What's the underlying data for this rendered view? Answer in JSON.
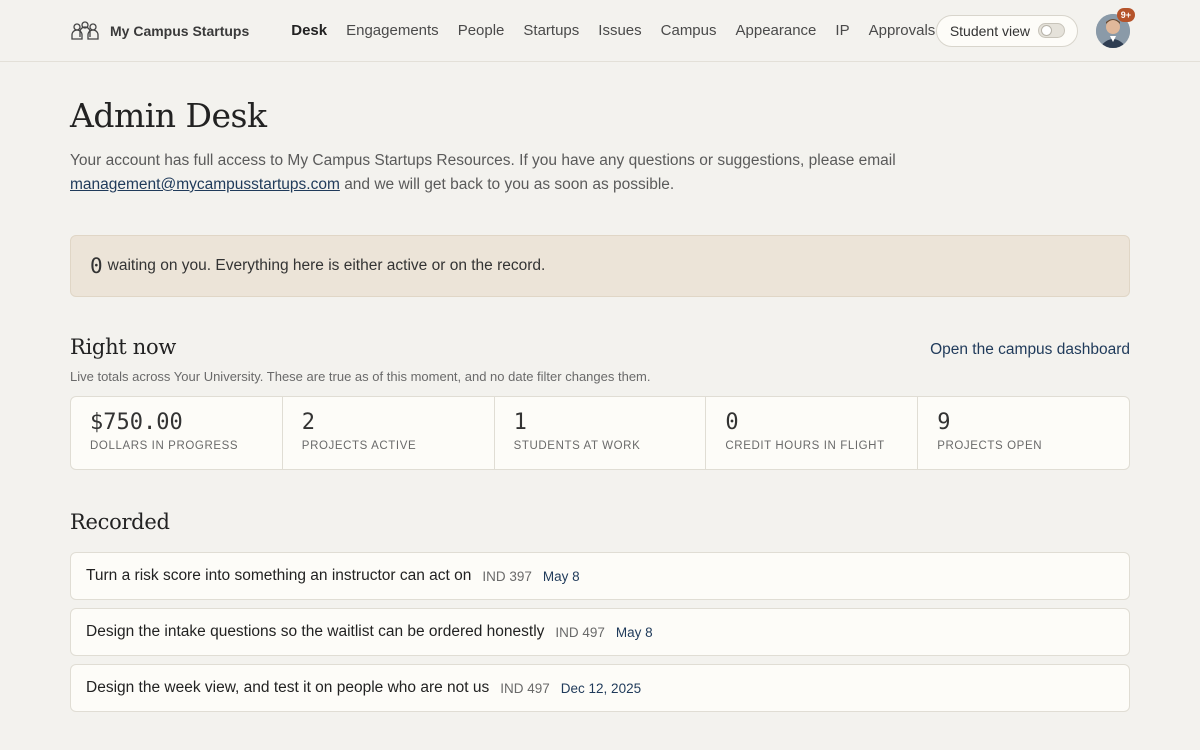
{
  "brand": {
    "name": "My Campus Startups",
    "logo_icon": "students-icon"
  },
  "nav": [
    {
      "label": "Desk",
      "active": true
    },
    {
      "label": "Engagements"
    },
    {
      "label": "People"
    },
    {
      "label": "Startups"
    },
    {
      "label": "Issues"
    },
    {
      "label": "Campus"
    },
    {
      "label": "Appearance"
    },
    {
      "label": "IP"
    },
    {
      "label": "Approvals"
    }
  ],
  "tools": {
    "student_view_label": "Student view",
    "student_view_on": false,
    "notifications_badge": "9+"
  },
  "page": {
    "title": "Admin Desk",
    "intro_text": "Your account has full access to My Campus Startups Resources. If you have any questions or suggestions, please email",
    "intro_email": "management@mycampusstartups.com",
    "intro_tail": "and we will get back to you as soon as possible."
  },
  "waiting": {
    "count": "0",
    "text": "waiting on you. Everything here is either active or on the record."
  },
  "right_now": {
    "title": "Right now",
    "dashboard_link": "Open the campus dashboard",
    "subtitle": "Live totals across Your University. These are true as of this moment, and no date filter changes them.",
    "stats": [
      {
        "value": "$750.00",
        "label": "DOLLARS IN PROGRESS"
      },
      {
        "value": "2",
        "label": "PROJECTS ACTIVE"
      },
      {
        "value": "1",
        "label": "STUDENTS AT WORK"
      },
      {
        "value": "0",
        "label": "CREDIT HOURS IN FLIGHT"
      },
      {
        "value": "9",
        "label": "PROJECTS OPEN"
      }
    ]
  },
  "recorded": {
    "title": "Recorded",
    "items": [
      {
        "title": "Turn a risk score into something an instructor can act on",
        "course": "IND 397",
        "date": "May 8"
      },
      {
        "title": "Design the intake questions so the waitlist can be ordered honestly",
        "course": "IND 497",
        "date": "May 8"
      },
      {
        "title": "Design the week view, and test it on people who are not us",
        "course": "IND 497",
        "date": "Dec 12, 2025"
      }
    ]
  },
  "colors": {
    "background": "#f3f2ee",
    "waiting_banner": "#ece4d8",
    "link": "#1f3a5a",
    "badge": "#b5542b"
  }
}
